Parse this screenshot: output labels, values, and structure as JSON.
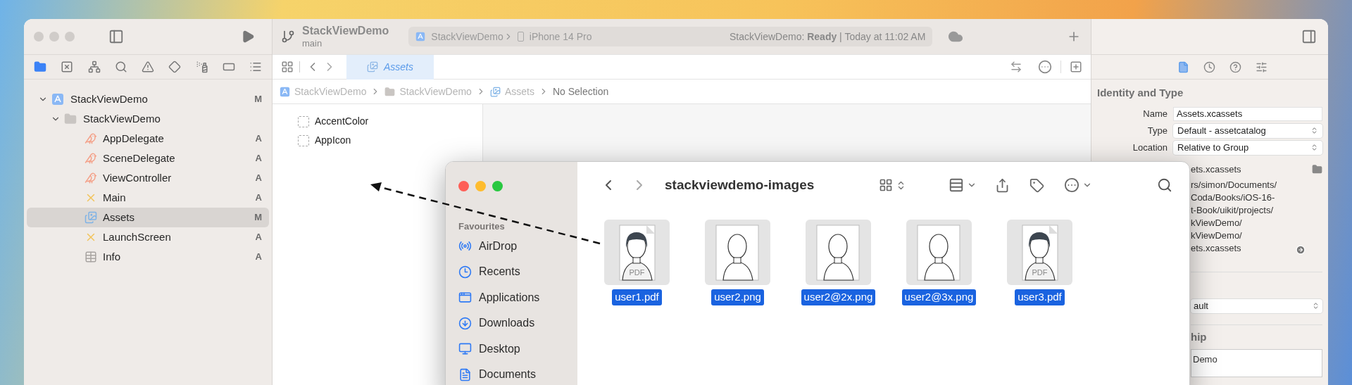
{
  "xcode": {
    "toolbar": {
      "project": "StackViewDemo",
      "branch": "main",
      "scheme": "StackViewDemo",
      "device": "iPhone 14 Pro",
      "status": "StackViewDemo: **Ready** | Today at 11:02 AM"
    },
    "navigator_tabs": [
      {
        "selected": true
      },
      {
        "selected": false
      },
      {
        "selected": false
      },
      {
        "selected": false
      },
      {
        "selected": false
      },
      {
        "selected": false
      },
      {
        "selected": false
      },
      {
        "selected": false
      },
      {
        "selected": false
      }
    ],
    "project_tree": [
      {
        "name": "StackViewDemo",
        "kind": "project",
        "badge": "M",
        "expanded": true,
        "selected": false,
        "children": [
          {
            "name": "StackViewDemo",
            "kind": "folder",
            "expanded": true,
            "selected": false,
            "children": [
              {
                "name": "AppDelegate",
                "kind": "swift",
                "badge": "A",
                "selected": false
              },
              {
                "name": "SceneDelegate",
                "kind": "swift",
                "badge": "A",
                "selected": false
              },
              {
                "name": "ViewController",
                "kind": "swift",
                "badge": "A",
                "selected": false
              },
              {
                "name": "Main",
                "kind": "storyboard",
                "badge": "A",
                "selected": false
              },
              {
                "name": "Assets",
                "kind": "assets",
                "badge": "M",
                "selected": true
              },
              {
                "name": "LaunchScreen",
                "kind": "storyboard",
                "badge": "A",
                "selected": false
              },
              {
                "name": "Info",
                "kind": "plist",
                "badge": "A",
                "selected": false
              }
            ]
          }
        ]
      }
    ],
    "editor_tab": {
      "label": "Assets",
      "selected": true
    },
    "breadcrumb": [
      {
        "label": "StackViewDemo",
        "kind": "project"
      },
      {
        "label": "StackViewDemo",
        "kind": "folder"
      },
      {
        "label": "Assets",
        "kind": "assets"
      },
      {
        "label": "No Selection",
        "kind": "none"
      }
    ],
    "asset_list": [
      "AccentColor",
      "AppIcon"
    ],
    "inspector": {
      "tabs": [
        {
          "selected": true
        },
        {
          "selected": false
        },
        {
          "selected": false
        },
        {
          "selected": false
        }
      ],
      "section_title": "Identity and Type",
      "fields": [
        {
          "label": "Name",
          "value": "Assets.xcassets",
          "kind": "text"
        },
        {
          "label": "Type",
          "value": "Default - assetcatalog",
          "kind": "popup"
        },
        {
          "label": "Location",
          "value": "Relative to Group",
          "kind": "popup"
        }
      ],
      "file_name": "ets.xcassets",
      "full_path": [
        "rs/simon/Documents/",
        "Coda/Books/iOS-16-",
        "t-Book/uikit/projects/",
        "kViewDemo/",
        "kViewDemo/",
        "ets.xcassets"
      ],
      "popup_value": "ault",
      "section2_title": "hip",
      "text_area": "Demo"
    }
  },
  "finder": {
    "title": "stackviewdemo-images",
    "sidebar_heading": "Favourites",
    "sidebar_items": [
      {
        "label": "AirDrop",
        "kind": "airdrop"
      },
      {
        "label": "Recents",
        "kind": "recents"
      },
      {
        "label": "Applications",
        "kind": "applications"
      },
      {
        "label": "Downloads",
        "kind": "downloads"
      },
      {
        "label": "Desktop",
        "kind": "desktop"
      },
      {
        "label": "Documents",
        "kind": "documents"
      }
    ],
    "files": [
      {
        "name": "user1.pdf",
        "kind": "pdf",
        "thumb_label": "PDF",
        "selected": true
      },
      {
        "name": "user2.png",
        "kind": "png",
        "selected": true
      },
      {
        "name": "user2@2x.png",
        "kind": "png",
        "selected": true
      },
      {
        "name": "user2@3x.png",
        "kind": "png",
        "selected": true
      },
      {
        "name": "user3.pdf",
        "kind": "pdf",
        "thumb_label": "PDF",
        "selected": true
      }
    ]
  }
}
